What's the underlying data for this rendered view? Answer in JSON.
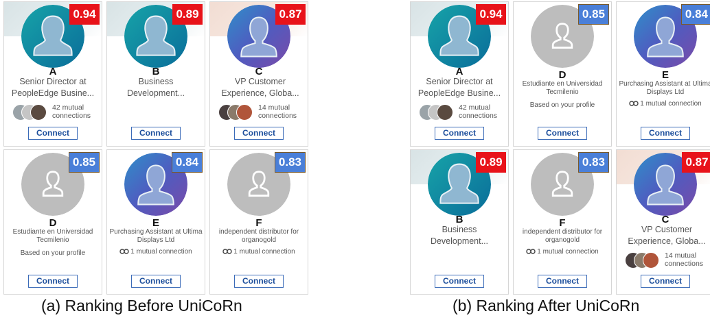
{
  "button_label": "Connect",
  "colors": {
    "score_high": "#e8131a",
    "score_low": "#4a7fd8",
    "connect_border": "#3b6bb8"
  },
  "panels": [
    {
      "caption": "(a) Ranking Before UniCoRn",
      "cards": [
        {
          "score": "0.94",
          "letter": "A",
          "title": "Senior Director at PeopleEdge Busine...",
          "mutual": "42 mutual connections"
        },
        {
          "score": "0.89",
          "letter": "B",
          "title": "Business Development..."
        },
        {
          "score": "0.87",
          "letter": "C",
          "title": "VP Customer Experience, Globa...",
          "mutual": "14 mutual connections"
        },
        {
          "score": "0.85",
          "letter": "D",
          "title": "Estudiante en Universidad Tecmilenio",
          "note": "Based on your profile"
        },
        {
          "score": "0.84",
          "letter": "E",
          "title": "Purchasing Assistant at Ultima Displays Ltd",
          "mutual": "1 mutual connection"
        },
        {
          "score": "0.83",
          "letter": "F",
          "title": "independent distributor for organogold",
          "mutual": "1 mutual connection"
        }
      ]
    },
    {
      "caption": "(b) Ranking After UniCoRn",
      "cards": [
        {
          "score": "0.94",
          "letter": "A",
          "title": "Senior Director at PeopleEdge Busine...",
          "mutual": "42 mutual connections"
        },
        {
          "score": "0.85",
          "letter": "D",
          "title": "Estudiante en Universidad Tecmilenio",
          "note": "Based on your profile"
        },
        {
          "score": "0.84",
          "letter": "E",
          "title": "Purchasing Assistant at Ultima Displays Ltd",
          "mutual": "1 mutual connection"
        },
        {
          "score": "0.89",
          "letter": "B",
          "title": "Business Development..."
        },
        {
          "score": "0.83",
          "letter": "F",
          "title": "independent distributor for organogold",
          "mutual": "1 mutual connection"
        },
        {
          "score": "0.87",
          "letter": "C",
          "title": "VP Customer Experience, Globa...",
          "mutual": "14 mutual connections"
        }
      ]
    }
  ]
}
